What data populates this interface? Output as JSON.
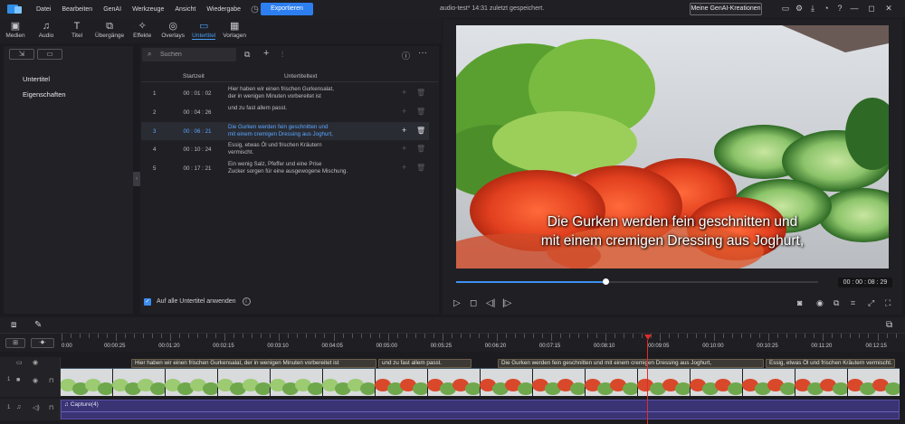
{
  "menubar": {
    "items": [
      "Datei",
      "Bearbeiten",
      "GenAI",
      "Werkzeuge",
      "Ansicht",
      "Wiedergabe"
    ],
    "export_label": "Exportieren",
    "file_title": "audio-test* 14:31 zuletzt gespeichert.",
    "genai_label": "Meine GenAI-Kreationen"
  },
  "library_tabs": [
    {
      "label": "Medien",
      "icon": "media-icon",
      "glyph": "▣"
    },
    {
      "label": "Audio",
      "icon": "music-icon",
      "glyph": "♫"
    },
    {
      "label": "Titel",
      "icon": "title-icon",
      "glyph": "T"
    },
    {
      "label": "Übergänge",
      "icon": "transition-icon",
      "glyph": "⧉"
    },
    {
      "label": "Effekte",
      "icon": "effects-icon",
      "glyph": "✧"
    },
    {
      "label": "Overlays",
      "icon": "overlay-icon",
      "glyph": "◎"
    },
    {
      "label": "Untertitel",
      "icon": "subtitle-icon",
      "glyph": "▭",
      "active": true
    },
    {
      "label": "Vorlagen",
      "icon": "template-icon",
      "glyph": "▦"
    }
  ],
  "sidebar": {
    "items": [
      {
        "label": "Untertitel",
        "active": true
      },
      {
        "label": "Eigenschaften",
        "active": false
      }
    ]
  },
  "subtitle_panel": {
    "search_placeholder": "Suchen",
    "col_start": "Startzeit",
    "col_text": "Untertiteltext",
    "rows": [
      {
        "n": "1",
        "time": "00 : 01 : 02",
        "line1": "Hier haben wir einen frischen Gurkensalat,",
        "line2": "der in wenigen Minuten vorbereitet ist",
        "selected": false
      },
      {
        "n": "2",
        "time": "00 : 04 : 26",
        "line1": "und zu fast allem passt.",
        "line2": "",
        "selected": false
      },
      {
        "n": "3",
        "time": "00 : 06 : 21",
        "line1": "Die Gurken werden fein geschnitten und",
        "line2": "mit einem cremigen Dressing aus Joghurt,",
        "selected": true
      },
      {
        "n": "4",
        "time": "00 : 10 : 24",
        "line1": "Essig, etwas Öl und frischen Kräutern",
        "line2": "vermischt.",
        "selected": false
      },
      {
        "n": "5",
        "time": "00 : 17 : 21",
        "line1": "Ein wenig Salz, Pfeffer und eine Prise",
        "line2": "Zucker sorgen für eine ausgewogene Mischung.",
        "selected": false
      }
    ],
    "apply_all_label": "Auf alle Untertitel anwenden",
    "apply_all_checked": true
  },
  "preview": {
    "subtitle_line1": "Die Gurken werden fein geschnitten und",
    "subtitle_line2": "mit einem cremigen Dressing aus Joghurt,",
    "timecode": "00 : 00 : 08 : 29",
    "progress_fraction": 0.415
  },
  "timeline": {
    "ruler_labels": [
      "0:00",
      "00:00:25",
      "00:01:20",
      "00:02:15",
      "00:03:10",
      "00:04:05",
      "00:05:00",
      "00:05:25",
      "00:06:20",
      "00:07:15",
      "00:08:10",
      "00:09:05",
      "00:10:00",
      "00:10:25",
      "00:11:20",
      "00:12:15"
    ],
    "subtitle_clips": [
      "Hier haben wir einen frischen Gurkensalat, der in wenigen Minuten vorbereitet ist",
      "und zu fast allem passt.",
      "Die Gurken werden fein geschnitten und mit einem cremigen Dressing aus Joghurt,",
      "Essig, etwas Öl und frischen Kräutern vermischt."
    ],
    "video_track_label": "1",
    "audio_track_label": "1",
    "audio_clip_name": "Capture(4)"
  },
  "colors": {
    "accent": "#2d7ff0",
    "active_tab": "#4a9cf5",
    "playhead": "#e02b2b",
    "audio_clip": "#3a3374"
  }
}
